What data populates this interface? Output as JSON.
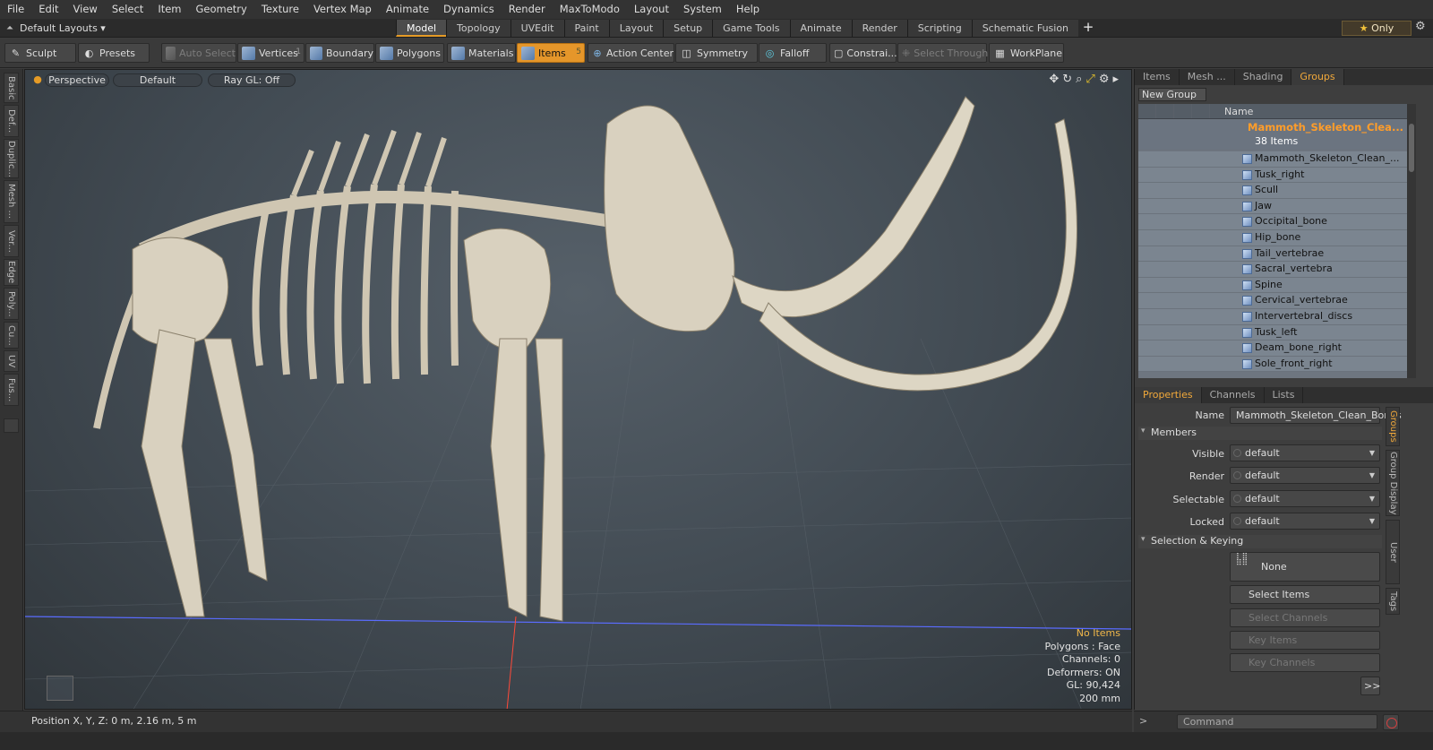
{
  "menu": [
    "File",
    "Edit",
    "View",
    "Select",
    "Item",
    "Geometry",
    "Texture",
    "Vertex Map",
    "Animate",
    "Dynamics",
    "Render",
    "MaxToModo",
    "Layout",
    "System",
    "Help"
  ],
  "layoutbar": {
    "layouts_label": "Default Layouts ▾",
    "tabs": [
      "Model",
      "Topology",
      "UVEdit",
      "Paint",
      "Layout",
      "Setup",
      "Game Tools",
      "Animate",
      "Render",
      "Scripting",
      "Schematic Fusion"
    ],
    "active_tab": "Model",
    "only_label": "Only"
  },
  "toolbar": {
    "sculpt": "Sculpt",
    "presets": "Presets",
    "auto_select": "Auto Select",
    "vertices": "Vertices",
    "vertices_count": "1",
    "boundary": "Boundary",
    "polygons": "Polygons",
    "materials": "Materials",
    "items": "Items",
    "items_count": "5",
    "action_center": "Action Center",
    "symmetry": "Symmetry",
    "falloff": "Falloff",
    "constraints": "Constrai...",
    "select_through": "Select Through",
    "workplane": "WorkPlane"
  },
  "lefttabs": [
    "Basic",
    "Def...",
    "Duplic...",
    "Mesh ...",
    "Ver...",
    "Edge",
    "Poly...",
    "Cu...",
    "UV",
    "Fus..."
  ],
  "viewport": {
    "view": "Perspective",
    "shading": "Default",
    "raygl": "Ray GL: Off",
    "info": {
      "selection": "No Items",
      "polygons": "Polygons : Face",
      "channels": "Channels: 0",
      "deformers": "Deformers: ON",
      "gl": "GL: 90,424",
      "scale": "200 mm"
    }
  },
  "outliner": {
    "tabs": [
      "Items",
      "Mesh ...",
      "Shading",
      "Groups"
    ],
    "active_tab": "Groups",
    "new_group": "New Group",
    "column_name": "Name",
    "parent": {
      "label": "Mammoth_Skeleton_Clea...",
      "count": "38 Items"
    },
    "items": [
      "Mammoth_Skeleton_Clean_...",
      "Tusk_right",
      "Scull",
      "Jaw",
      "Occipital_bone",
      "Hip_bone",
      "Tail_vertebrae",
      "Sacral_vertebra",
      "Spine",
      "Cervical_vertebrae",
      "Intervertebral_discs",
      "Tusk_left",
      "Deam_bone_right",
      "Sole_front_right"
    ]
  },
  "properties": {
    "tabs": [
      "Properties",
      "Channels",
      "Lists"
    ],
    "active_tab": "Properties",
    "name_label": "Name",
    "name_value": "Mammoth_Skeleton_Clean_Bones",
    "members_section": "Members",
    "visible_label": "Visible",
    "visible_value": "default",
    "render_label": "Render",
    "render_value": "default",
    "selectable_label": "Selectable",
    "selectable_value": "default",
    "locked_label": "Locked",
    "locked_value": "default",
    "selkey_section": "Selection & Keying",
    "none_label": "None",
    "select_items": "Select Items",
    "select_channels": "Select Channels",
    "key_items": "Key Items",
    "key_channels": "Key Channels",
    "more": ">>",
    "side_tabs": [
      "Groups",
      "Group Display",
      "User Channels",
      "Tags"
    ]
  },
  "status": {
    "position": "Position X, Y, Z:   0 m, 2.16 m, 5 m",
    "command_placeholder": "Command"
  }
}
